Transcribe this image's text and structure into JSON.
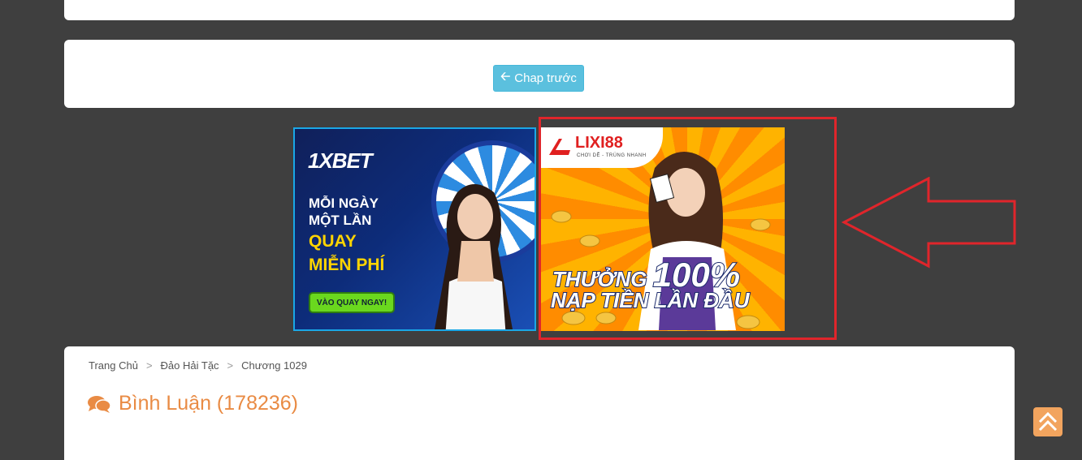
{
  "nav": {
    "prev_label": "Chap trước"
  },
  "ads": {
    "xbet": {
      "logo": "1XBET",
      "line1": "MỖI NGÀY",
      "line2": "MỘT LẦN",
      "line3": "QUAY",
      "line4": "MIỄN PHÍ",
      "cta": "VÀO QUAY NGAY!"
    },
    "lixi": {
      "logo": "LIXI88",
      "tagline": "CHƠI DỄ - TRÚNG NHANH",
      "line1a": "THƯỞNG ",
      "line1b": "100%",
      "line2": "NẠP TIỀN LẦN ĐẦU"
    }
  },
  "breadcrumb": {
    "home": "Trang Chủ",
    "series": "Đảo Hải Tặc",
    "chapter": "Chương 1029"
  },
  "comments": {
    "title": "Bình Luận (178236)"
  },
  "colors": {
    "background": "#3f3f3f",
    "button": "#5bc0de",
    "accent_orange": "#e98b44",
    "highlight_red": "#e0252b"
  },
  "icons": {
    "prev": "arrow-left-icon",
    "comments": "comments-icon",
    "scroll_top": "double-chevron-up-icon"
  }
}
